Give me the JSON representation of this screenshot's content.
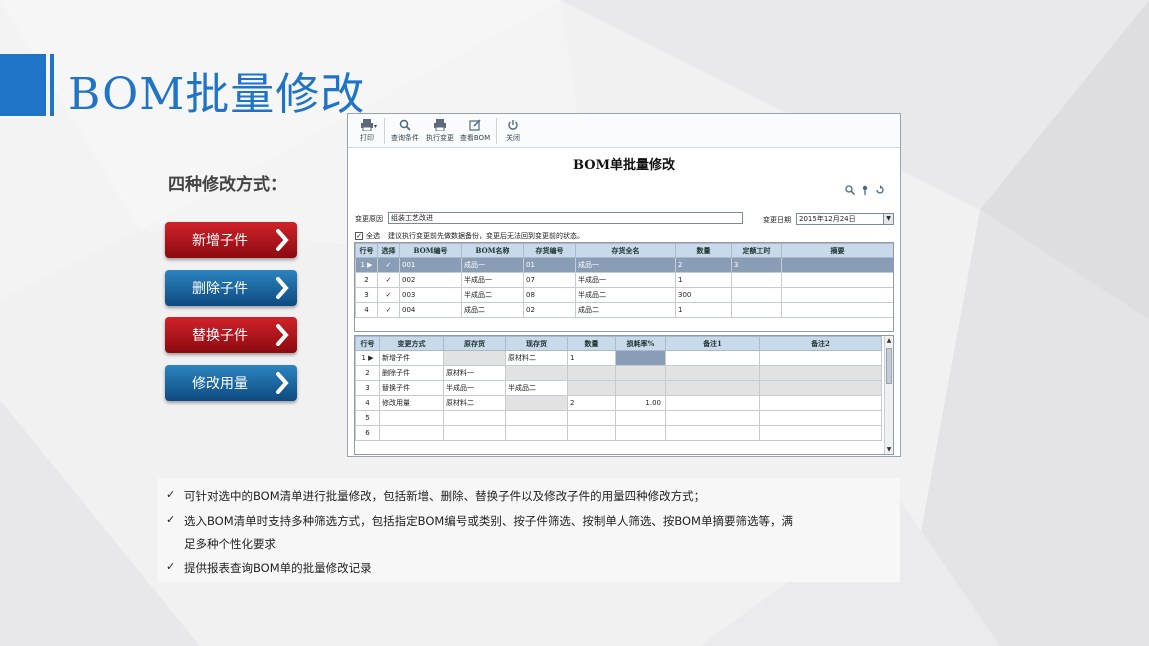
{
  "slide": {
    "title": "BOM批量修改",
    "section_heading": "四种修改方式：",
    "modes": [
      {
        "label": "新增子件",
        "color": "#b4151c"
      },
      {
        "label": "删除子件",
        "color": "#1b66a6"
      },
      {
        "label": "替换子件",
        "color": "#b4151c"
      },
      {
        "label": "修改用量",
        "color": "#1b66a6"
      }
    ],
    "notes": [
      "可针对选中的BOM清单进行批量修改，包括新增、删除、替换子件以及修改子件的用量四种修改方式；",
      "选入BOM清单时支持多种筛选方式，包括指定BOM编号或类别、按子件筛选、按制单人筛选、按BOM单摘要筛选等，满",
      "足多种个性化要求",
      "提供报表查询BOM单的批量修改记录"
    ],
    "accent_color": "#1f74c7"
  },
  "app": {
    "toolbar": [
      {
        "label": "打印",
        "icon": "printer-icon"
      },
      {
        "label": "查询条件",
        "icon": "magnifier-icon"
      },
      {
        "label": "执行变更",
        "icon": "printer-icon"
      },
      {
        "label": "查看BOM",
        "icon": "edit-icon"
      },
      {
        "label": "关闭",
        "icon": "power-icon"
      }
    ],
    "dialog_title": "BOM单批量修改",
    "reason_label": "变更原因",
    "reason_value": "组装工艺改进",
    "date_label": "变更日期",
    "date_value": "2015年12月24日",
    "select_all_label": "全选",
    "hint": "建议执行变更前先做数据备份，变更后无法回到变更前的状态。",
    "bom_table": {
      "headers": [
        "行号",
        "选择",
        "BOM编号",
        "BOM名称",
        "存货编号",
        "存货全名",
        "数量",
        "定额工时",
        "摘要"
      ],
      "rows": [
        [
          "1",
          "✓",
          "001",
          "成品一",
          "01",
          "成品一",
          "2",
          "3",
          ""
        ],
        [
          "2",
          "✓",
          "002",
          "半成品一",
          "07",
          "半成品一",
          "1",
          "",
          ""
        ],
        [
          "3",
          "✓",
          "003",
          "半成品二",
          "08",
          "半成品二",
          "300",
          "",
          ""
        ],
        [
          "4",
          "✓",
          "004",
          "成品二",
          "02",
          "成品二",
          "1",
          "",
          ""
        ]
      ]
    },
    "change_table": {
      "headers": [
        "行号",
        "变更方式",
        "原存货",
        "现存货",
        "数量",
        "损耗率%",
        "备注1",
        "备注2"
      ],
      "rows": [
        [
          "1",
          "新增子件",
          "",
          "原材料二",
          "1",
          "",
          "",
          ""
        ],
        [
          "2",
          "删除子件",
          "原材料一",
          "",
          "",
          "",
          "",
          ""
        ],
        [
          "3",
          "替换子件",
          "半成品一",
          "半成品二",
          "",
          "",
          "",
          ""
        ],
        [
          "4",
          "修改用量",
          "原材料二",
          "",
          "2",
          "1.00",
          "",
          ""
        ],
        [
          "5",
          "",
          "",
          "",
          "",
          "",
          "",
          ""
        ],
        [
          "6",
          "",
          "",
          "",
          "",
          "",
          "",
          ""
        ]
      ]
    }
  }
}
